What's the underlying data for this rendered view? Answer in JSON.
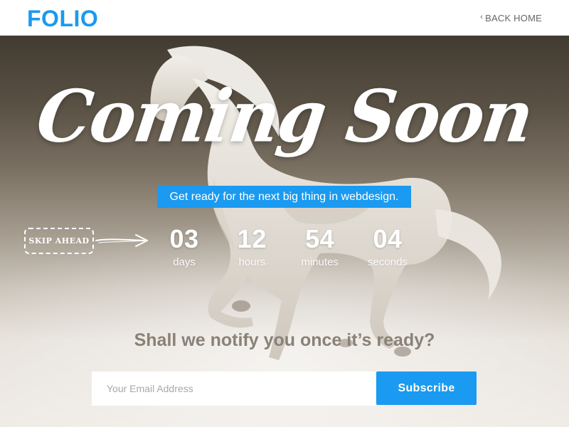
{
  "header": {
    "logo": "FOLIO",
    "back_home_label": "BACK HOME",
    "back_home_icon": "chevron-left-icon"
  },
  "hero": {
    "title": "Coming Soon",
    "tagline": "Get ready for the next big thing in webdesign.",
    "skip_label": "SKIP AHEAD",
    "countdown": [
      {
        "value": "03",
        "label": "days"
      },
      {
        "value": "12",
        "label": "hours"
      },
      {
        "value": "54",
        "label": "minutes"
      },
      {
        "value": "04",
        "label": "seconds"
      }
    ],
    "notify_text": "Shall we notify you once it’s ready?"
  },
  "form": {
    "email_placeholder": "Your Email Address",
    "subscribe_label": "Subscribe"
  },
  "colors": {
    "accent": "#1a9af0",
    "notify_text": "#8a8177"
  }
}
